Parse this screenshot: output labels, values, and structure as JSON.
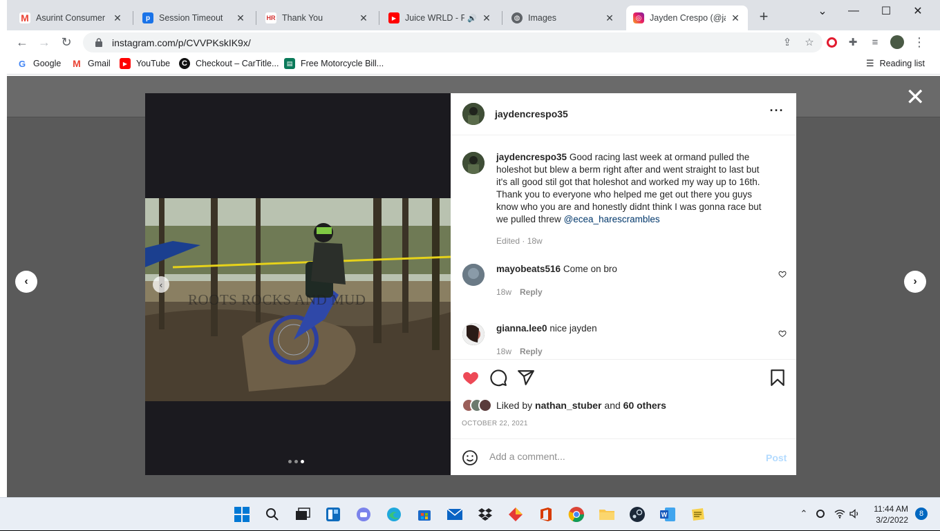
{
  "browser": {
    "tabs": [
      {
        "label": "Asurint Consumer Re",
        "icon": "gmail-icon"
      },
      {
        "label": "Session Timeout",
        "icon": "paypal-icon"
      },
      {
        "label": "Thank You",
        "icon": "hr-icon"
      },
      {
        "label": "Juice WRLD - Fla",
        "icon": "youtube-icon"
      },
      {
        "label": "Images",
        "icon": "globe-icon"
      },
      {
        "label": "Jayden Crespo (@jay",
        "icon": "instagram-icon",
        "active": true
      }
    ],
    "url": "instagram.com/p/CVVPKskIK9x/",
    "bookmarks": [
      {
        "label": "Google",
        "icon": "google-icon"
      },
      {
        "label": "Gmail",
        "icon": "gmail-icon"
      },
      {
        "label": "YouTube",
        "icon": "youtube-icon"
      },
      {
        "label": "Checkout – CarTitle...",
        "icon": "cartitle-icon"
      },
      {
        "label": "Free Motorcycle Bill...",
        "icon": "document-icon"
      }
    ],
    "reading_list": "Reading list"
  },
  "post": {
    "username": "jaydencrespo35",
    "caption_username": "jaydencrespo35",
    "caption_lines": [
      "Good racing last week at ormand pulled the",
      "holeshot but blew a berm right after and went straight to last but",
      "it's all good stil got that holeshot and worked my way up to 16th.",
      "Thank you to everyone who helped me get out there you guys",
      "know who you are and honestly didnt think I was gonna race but",
      "we pulled threw"
    ],
    "caption_mention": "@ecea_harescrambles",
    "caption_meta": "Edited · 18w",
    "watermark": "ROOTS ROCKS AND MUD",
    "comments": [
      {
        "username": "mayobeats516",
        "text": "Come on bro",
        "age": "18w",
        "reply": "Reply"
      },
      {
        "username": "gianna.lee0",
        "text": "nice jayden",
        "age": "18w",
        "reply": "Reply"
      }
    ],
    "liked_by_prefix": "Liked by",
    "liked_by_user": "nathan_stuber",
    "liked_by_and": "and",
    "liked_by_others": "60 others",
    "date": "OCTOBER 22, 2021",
    "comment_placeholder": "Add a comment...",
    "post_label": "Post",
    "carousel_total": 3,
    "carousel_active": 3
  },
  "taskbar": {
    "time": "11:44 AM",
    "date": "3/2/2022",
    "notifications": "8"
  },
  "colors": {
    "like_red": "#ed4956",
    "link_blue": "#00376b",
    "post_disabled": "#b3dbff"
  }
}
